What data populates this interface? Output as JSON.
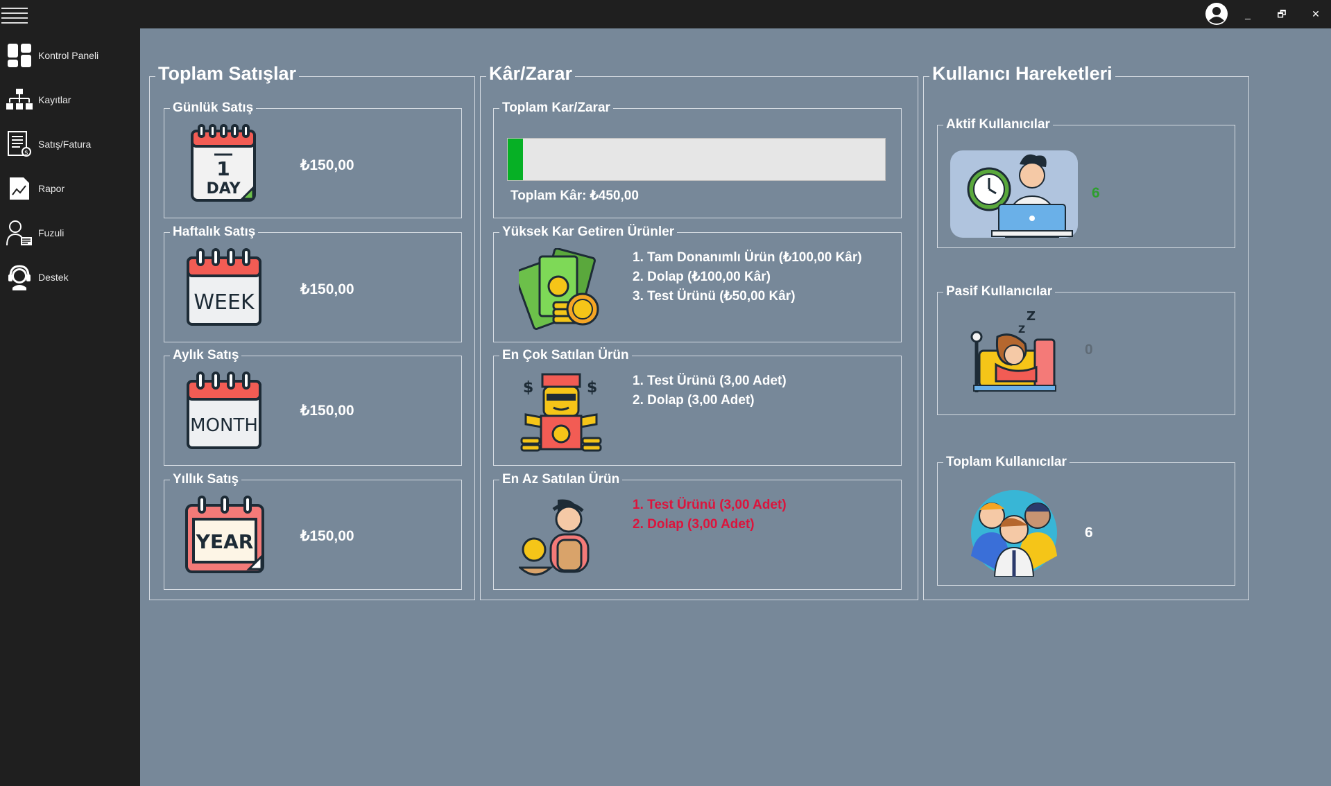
{
  "window": {
    "minimize": "_",
    "restore": "🗗",
    "close": "✕"
  },
  "sidebar": {
    "items": [
      {
        "label": "Kontrol Paneli",
        "icon": "dashboard-icon"
      },
      {
        "label": "Kayıtlar",
        "icon": "hierarchy-icon"
      },
      {
        "label": "Satış/Fatura",
        "icon": "invoice-icon"
      },
      {
        "label": "Rapor",
        "icon": "chart-icon"
      },
      {
        "label": "Fuzuli",
        "icon": "person-desk-icon"
      },
      {
        "label": "Destek",
        "icon": "headset-icon"
      }
    ]
  },
  "sales": {
    "title": "Toplam Satışlar",
    "daily": {
      "title": "Günlük Satış",
      "value": "₺150,00",
      "icon_text": "DAY",
      "icon_number": "1"
    },
    "weekly": {
      "title": "Haftalık Satış",
      "value": "₺150,00",
      "icon_text": "WEEK"
    },
    "monthly": {
      "title": "Aylık Satış",
      "value": "₺150,00",
      "icon_text": "MONTH"
    },
    "yearly": {
      "title": "Yıllık Satış",
      "value": "₺150,00",
      "icon_text": "YEAR"
    }
  },
  "profit": {
    "title": "Kâr/Zarar",
    "total": {
      "title": "Toplam Kar/Zarar",
      "progress_fraction": 0.04,
      "label": "Toplam Kâr: ₺450,00"
    },
    "top_profit": {
      "title": "Yüksek Kar Getiren Ürünler",
      "items": [
        "1. Tam Donanımlı Ürün (₺100,00 Kâr)",
        "2. Dolap (₺100,00 Kâr)",
        "3. Test Ürünü (₺50,00 Kâr)"
      ]
    },
    "best_selling": {
      "title": "En Çok Satılan Ürün",
      "items": [
        "1. Test Ürünü (3,00 Adet)",
        "2. Dolap (3,00 Adet)"
      ]
    },
    "least_selling": {
      "title": "En Az Satılan Ürün",
      "items": [
        "1. Test Ürünü (3,00 Adet)",
        "2. Dolap (3,00 Adet)"
      ]
    }
  },
  "users": {
    "title": "Kullanıcı Hareketleri",
    "active": {
      "title": "Aktif Kullanıcılar",
      "count": "6"
    },
    "passive": {
      "title": "Pasif Kullanıcılar",
      "count": "0",
      "sleep_glyph": "Z"
    },
    "total": {
      "title": "Toplam Kullanıcılar",
      "count": "6"
    }
  },
  "colors": {
    "accent_green": "#06b025",
    "count_green": "#2e9e2e",
    "count_gray": "#5f6b76",
    "red_text": "#dc143c",
    "panel_bg": "#778899",
    "sidebar_bg": "#1f1f1f"
  }
}
